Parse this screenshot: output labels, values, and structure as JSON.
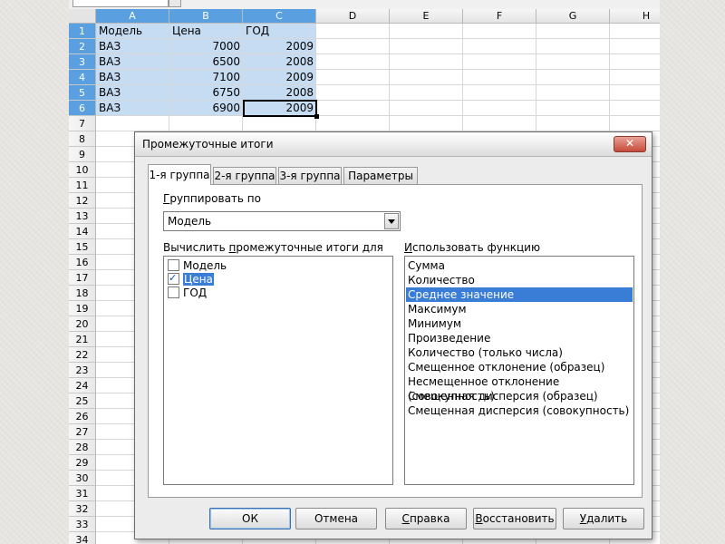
{
  "spreadsheet": {
    "columns": [
      "A",
      "B",
      "C",
      "D",
      "E",
      "F",
      "G",
      "H"
    ],
    "rows": [
      "1",
      "2",
      "3",
      "4",
      "5",
      "6",
      "7",
      "8",
      "9",
      "10",
      "11",
      "12",
      "13",
      "14",
      "15",
      "16",
      "17",
      "18",
      "19",
      "20",
      "21",
      "22",
      "23",
      "24",
      "25",
      "26",
      "27",
      "28",
      "29",
      "30",
      "31",
      "32",
      "33",
      "34"
    ],
    "cells": [
      [
        "Модель",
        "Цена",
        "ГОД"
      ],
      [
        "ВАЗ",
        "7000",
        "2009"
      ],
      [
        "ВАЗ",
        "6500",
        "2008"
      ],
      [
        "ВАЗ",
        "7100",
        "2009"
      ],
      [
        "ВАЗ",
        "6750",
        "2008"
      ],
      [
        "ВАЗ",
        "6900",
        "2009"
      ]
    ],
    "selection_color": "#c6dcf2",
    "header_selected_color": "#5aa0e0"
  },
  "dialog": {
    "title": "Промежуточные итоги",
    "close_symbol": "✕",
    "tabs": [
      "1-я группа",
      "2-я группа",
      "3-я группа",
      "Параметры"
    ],
    "group_by": {
      "label_first": "Г",
      "label_rest": "руппировать по",
      "value": "Модель"
    },
    "compute_for": {
      "label_pre": "Вычислить ",
      "label_underlined": "п",
      "label_post": "ромежуточные итоги для",
      "items": [
        {
          "label": "Модель",
          "checked": false
        },
        {
          "label": "Цена",
          "checked": true
        },
        {
          "label": "ГОД",
          "checked": false
        }
      ]
    },
    "use_function": {
      "label_first": "И",
      "label_rest": "спользовать функцию",
      "items": [
        "Сумма",
        "Количество",
        "Среднее значение",
        "Максимум",
        "Минимум",
        "Произведение",
        "Количество (только числа)",
        "Смещенное отклонение (образец)",
        "Несмещенное отклонение (совокупность)",
        "Смещенная дисперсия (образец)",
        "Смещенная дисперсия (совокупность)"
      ],
      "selected_index": 2
    },
    "buttons": {
      "ok": "ОК",
      "cancel": "Отмена",
      "help_first": "С",
      "help_rest": "правка",
      "reset_first": "В",
      "reset_rest": "осстановить",
      "delete_first": "У",
      "delete_rest": "далить"
    },
    "accent_color": "#3a7dd6"
  }
}
